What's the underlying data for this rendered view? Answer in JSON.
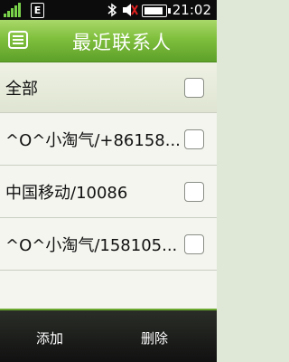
{
  "status": {
    "network_badge": "E",
    "time": "21:02"
  },
  "header": {
    "title": "最近联系人"
  },
  "list": {
    "all_label": "全部",
    "items": [
      {
        "label": "^O^小淘气/+86158..."
      },
      {
        "label": "中国移动/10086"
      },
      {
        "label": "^O^小淘气/158105..."
      }
    ]
  },
  "footer": {
    "left_label": "添加",
    "right_label": "删除"
  },
  "colors": {
    "title_bar": "#7fbf3d",
    "status_bar": "#0c0c0c",
    "bottom_bar": "#111111"
  }
}
